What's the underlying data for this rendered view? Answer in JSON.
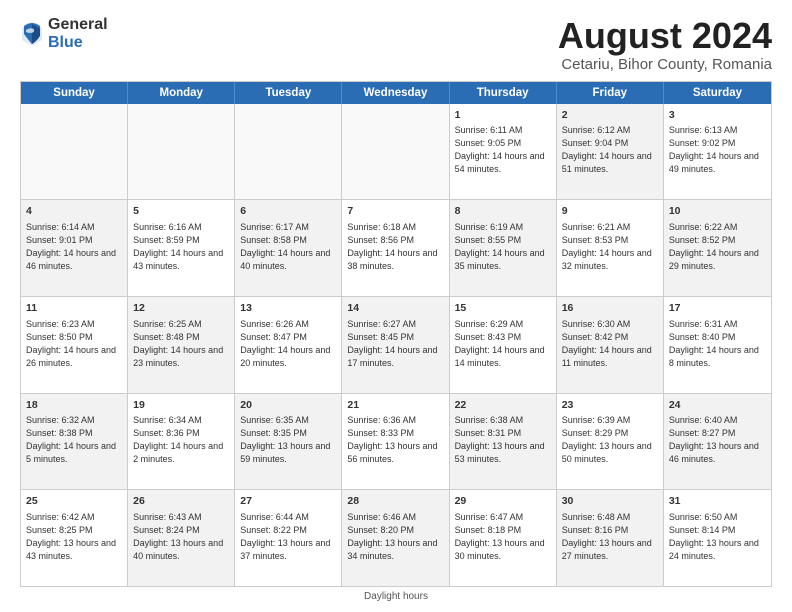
{
  "logo": {
    "general": "General",
    "blue": "Blue"
  },
  "title": {
    "month": "August 2024",
    "location": "Cetariu, Bihor County, Romania"
  },
  "header_days": [
    "Sunday",
    "Monday",
    "Tuesday",
    "Wednesday",
    "Thursday",
    "Friday",
    "Saturday"
  ],
  "rows": [
    [
      {
        "day": "",
        "text": "",
        "empty": true
      },
      {
        "day": "",
        "text": "",
        "empty": true
      },
      {
        "day": "",
        "text": "",
        "empty": true
      },
      {
        "day": "",
        "text": "",
        "empty": true
      },
      {
        "day": "1",
        "text": "Sunrise: 6:11 AM\nSunset: 9:05 PM\nDaylight: 14 hours and 54 minutes."
      },
      {
        "day": "2",
        "text": "Sunrise: 6:12 AM\nSunset: 9:04 PM\nDaylight: 14 hours and 51 minutes.",
        "shaded": true
      },
      {
        "day": "3",
        "text": "Sunrise: 6:13 AM\nSunset: 9:02 PM\nDaylight: 14 hours and 49 minutes."
      }
    ],
    [
      {
        "day": "4",
        "text": "Sunrise: 6:14 AM\nSunset: 9:01 PM\nDaylight: 14 hours and 46 minutes.",
        "shaded": true
      },
      {
        "day": "5",
        "text": "Sunrise: 6:16 AM\nSunset: 8:59 PM\nDaylight: 14 hours and 43 minutes."
      },
      {
        "day": "6",
        "text": "Sunrise: 6:17 AM\nSunset: 8:58 PM\nDaylight: 14 hours and 40 minutes.",
        "shaded": true
      },
      {
        "day": "7",
        "text": "Sunrise: 6:18 AM\nSunset: 8:56 PM\nDaylight: 14 hours and 38 minutes."
      },
      {
        "day": "8",
        "text": "Sunrise: 6:19 AM\nSunset: 8:55 PM\nDaylight: 14 hours and 35 minutes.",
        "shaded": true
      },
      {
        "day": "9",
        "text": "Sunrise: 6:21 AM\nSunset: 8:53 PM\nDaylight: 14 hours and 32 minutes."
      },
      {
        "day": "10",
        "text": "Sunrise: 6:22 AM\nSunset: 8:52 PM\nDaylight: 14 hours and 29 minutes.",
        "shaded": true
      }
    ],
    [
      {
        "day": "11",
        "text": "Sunrise: 6:23 AM\nSunset: 8:50 PM\nDaylight: 14 hours and 26 minutes."
      },
      {
        "day": "12",
        "text": "Sunrise: 6:25 AM\nSunset: 8:48 PM\nDaylight: 14 hours and 23 minutes.",
        "shaded": true
      },
      {
        "day": "13",
        "text": "Sunrise: 6:26 AM\nSunset: 8:47 PM\nDaylight: 14 hours and 20 minutes."
      },
      {
        "day": "14",
        "text": "Sunrise: 6:27 AM\nSunset: 8:45 PM\nDaylight: 14 hours and 17 minutes.",
        "shaded": true
      },
      {
        "day": "15",
        "text": "Sunrise: 6:29 AM\nSunset: 8:43 PM\nDaylight: 14 hours and 14 minutes."
      },
      {
        "day": "16",
        "text": "Sunrise: 6:30 AM\nSunset: 8:42 PM\nDaylight: 14 hours and 11 minutes.",
        "shaded": true
      },
      {
        "day": "17",
        "text": "Sunrise: 6:31 AM\nSunset: 8:40 PM\nDaylight: 14 hours and 8 minutes."
      }
    ],
    [
      {
        "day": "18",
        "text": "Sunrise: 6:32 AM\nSunset: 8:38 PM\nDaylight: 14 hours and 5 minutes.",
        "shaded": true
      },
      {
        "day": "19",
        "text": "Sunrise: 6:34 AM\nSunset: 8:36 PM\nDaylight: 14 hours and 2 minutes."
      },
      {
        "day": "20",
        "text": "Sunrise: 6:35 AM\nSunset: 8:35 PM\nDaylight: 13 hours and 59 minutes.",
        "shaded": true
      },
      {
        "day": "21",
        "text": "Sunrise: 6:36 AM\nSunset: 8:33 PM\nDaylight: 13 hours and 56 minutes."
      },
      {
        "day": "22",
        "text": "Sunrise: 6:38 AM\nSunset: 8:31 PM\nDaylight: 13 hours and 53 minutes.",
        "shaded": true
      },
      {
        "day": "23",
        "text": "Sunrise: 6:39 AM\nSunset: 8:29 PM\nDaylight: 13 hours and 50 minutes."
      },
      {
        "day": "24",
        "text": "Sunrise: 6:40 AM\nSunset: 8:27 PM\nDaylight: 13 hours and 46 minutes.",
        "shaded": true
      }
    ],
    [
      {
        "day": "25",
        "text": "Sunrise: 6:42 AM\nSunset: 8:25 PM\nDaylight: 13 hours and 43 minutes."
      },
      {
        "day": "26",
        "text": "Sunrise: 6:43 AM\nSunset: 8:24 PM\nDaylight: 13 hours and 40 minutes.",
        "shaded": true
      },
      {
        "day": "27",
        "text": "Sunrise: 6:44 AM\nSunset: 8:22 PM\nDaylight: 13 hours and 37 minutes."
      },
      {
        "day": "28",
        "text": "Sunrise: 6:46 AM\nSunset: 8:20 PM\nDaylight: 13 hours and 34 minutes.",
        "shaded": true
      },
      {
        "day": "29",
        "text": "Sunrise: 6:47 AM\nSunset: 8:18 PM\nDaylight: 13 hours and 30 minutes."
      },
      {
        "day": "30",
        "text": "Sunrise: 6:48 AM\nSunset: 8:16 PM\nDaylight: 13 hours and 27 minutes.",
        "shaded": true
      },
      {
        "day": "31",
        "text": "Sunrise: 6:50 AM\nSunset: 8:14 PM\nDaylight: 13 hours and 24 minutes."
      }
    ]
  ],
  "footer": "Daylight hours"
}
